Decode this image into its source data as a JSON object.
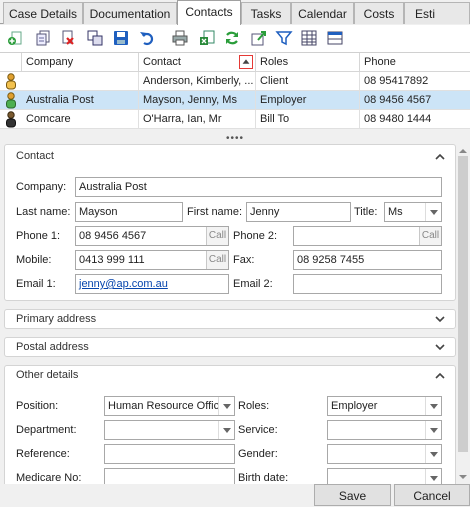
{
  "tabs": [
    {
      "label": "Case Details"
    },
    {
      "label": "Documentation"
    },
    {
      "label": "Contacts"
    },
    {
      "label": "Tasks"
    },
    {
      "label": "Calendar"
    },
    {
      "label": "Costs"
    },
    {
      "label": "Esti"
    }
  ],
  "toolbar": {
    "icons": [
      "add-contact-icon",
      "copy-contact-icon",
      "delete-contact-icon",
      "duplicate-icon",
      "save-icon",
      "undo-icon",
      "print-icon",
      "export-icon",
      "refresh-icon",
      "import-icon",
      "filter-icon",
      "columns-icon",
      "layout-icon"
    ]
  },
  "grid": {
    "headers": [
      "Company",
      "Contact",
      "Roles",
      "Phone"
    ],
    "rows": [
      {
        "company": "",
        "contact": "Anderson, Kimberly, ...",
        "role": "Client",
        "phone": "08 95417892"
      },
      {
        "company": "Australia Post",
        "contact": "Mayson, Jenny, Ms",
        "role": "Employer",
        "phone": "08 9456 4567"
      },
      {
        "company": "Comcare",
        "contact": "O'Harra, Ian, Mr",
        "role": "Bill To",
        "phone": "08 9480 1444"
      }
    ]
  },
  "splitter": "••••",
  "contact": {
    "title": "Contact",
    "company_label": "Company:",
    "company": "Australia Post",
    "lastname_label": "Last name:",
    "lastname": "Mayson",
    "firstname_label": "First name:",
    "firstname": "Jenny",
    "title_label": "Title:",
    "title_value": "Ms",
    "phone1_label": "Phone 1:",
    "phone1": "08 9456 4567",
    "phone2_label": "Phone 2:",
    "phone2": "",
    "mobile_label": "Mobile:",
    "mobile": "0413 999 111",
    "fax_label": "Fax:",
    "fax": "08 9258 7455",
    "email1_label": "Email 1:",
    "email1": "jenny@ap.com.au",
    "email2_label": "Email 2:",
    "email2": "",
    "call_label": "Call"
  },
  "sections": {
    "primary": "Primary address",
    "postal": "Postal address",
    "other": "Other details"
  },
  "other": {
    "position_label": "Position:",
    "position": "Human Resource Offic",
    "roles_label": "Roles:",
    "roles": "Employer",
    "department_label": "Department:",
    "department": "",
    "service_label": "Service:",
    "service": "",
    "reference_label": "Reference:",
    "reference": "",
    "gender_label": "Gender:",
    "gender": "",
    "medicare_label": "Medicare No:",
    "medicare": "",
    "birth_label": "Birth date:",
    "birth": ""
  },
  "buttons": {
    "save": "Save",
    "cancel": "Cancel"
  }
}
